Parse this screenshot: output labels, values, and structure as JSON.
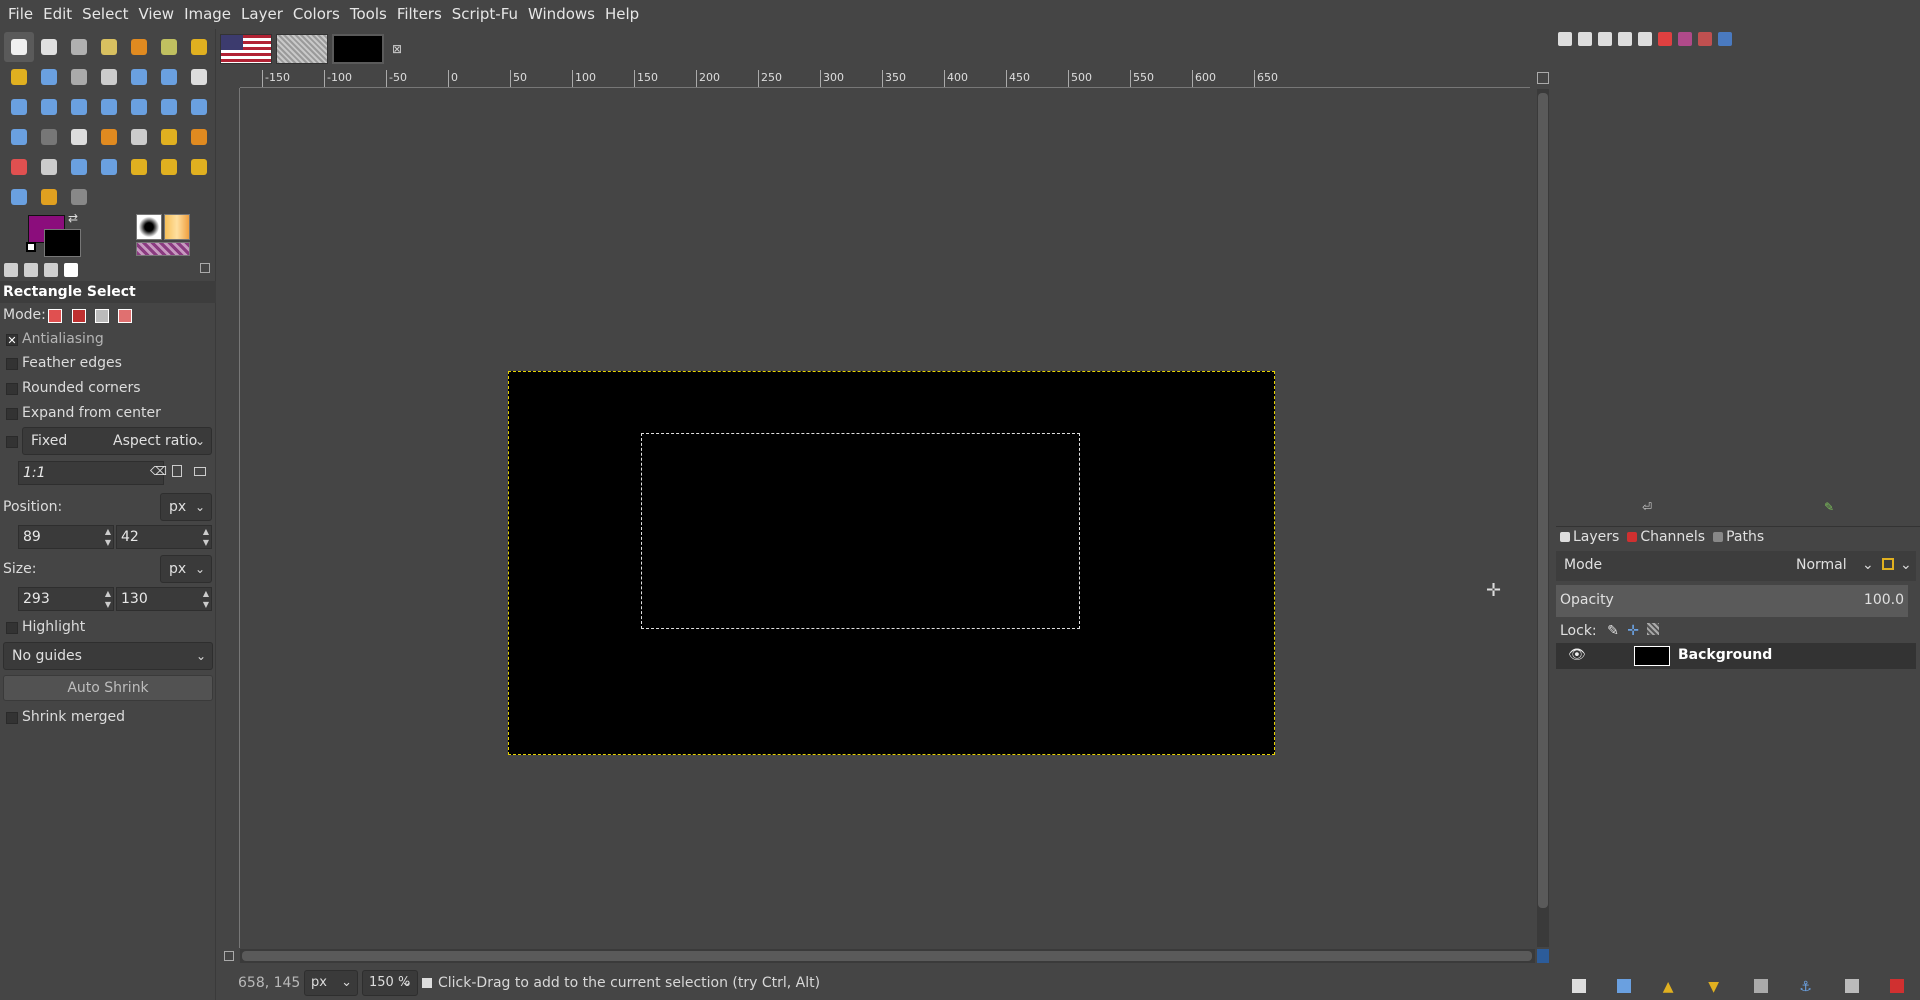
{
  "menubar": {
    "items": [
      "File",
      "Edit",
      "Select",
      "View",
      "Image",
      "Layer",
      "Colors",
      "Tools",
      "Filters",
      "Script-Fu",
      "Windows",
      "Help"
    ]
  },
  "colors": {
    "foreground": "#8b0d7c",
    "background": "#000000",
    "selection_marching": "#e6d200"
  },
  "tool_options": {
    "title": "Rectangle Select",
    "mode_label": "Mode:",
    "antialiasing": "Antialiasing",
    "feather_edges": "Feather edges",
    "rounded_corners": "Rounded corners",
    "expand_from_center": "Expand from center",
    "fixed_label": "Fixed",
    "fixed_value": "Aspect ratio",
    "ratio_value": "1:1",
    "position_label": "Position:",
    "position_unit": "px",
    "position_x": "89",
    "position_y": "42",
    "size_label": "Size:",
    "size_unit": "px",
    "size_w": "293",
    "size_h": "130",
    "highlight": "Highlight",
    "guides_value": "No guides",
    "auto_shrink": "Auto Shrink",
    "shrink_merged": "Shrink merged"
  },
  "ruler": {
    "labels": [
      "-150",
      "-100",
      "-50",
      "0",
      "50",
      "100",
      "150",
      "200",
      "250",
      "300",
      "350",
      "400",
      "450",
      "500",
      "550",
      "600",
      "650"
    ]
  },
  "statusbar": {
    "coords": "658, 145",
    "unit": "px",
    "zoom": "150 %",
    "message": "Click-Drag to add to the current selection (try Ctrl, Alt)"
  },
  "layers": {
    "tabs": [
      "Layers",
      "Channels",
      "Paths"
    ],
    "mode_label": "Mode",
    "mode_value": "Normal",
    "opacity_label": "Opacity",
    "opacity_value": "100.0",
    "lock_label": "Lock:",
    "layer_name": "Background"
  },
  "icons": {
    "tools": [
      "rect-select-icon",
      "ellipse-select-icon",
      "free-select-icon",
      "fuzzy-select-icon",
      "select-by-color-icon",
      "scissors-icon",
      "foreground-select-icon",
      "paths-icon",
      "color-picker-icon",
      "zoom-icon",
      "measure-icon",
      "move-icon",
      "align-icon",
      "crop-icon",
      "unified-transform-icon",
      "rotate-icon",
      "scale-icon",
      "shear-icon",
      "warp-icon",
      "perspective-icon",
      "flip-icon",
      "cage-icon",
      "handle-transform-icon",
      "text-icon",
      "bucket-fill-icon",
      "gradient-icon",
      "pencil-icon",
      "paintbrush-icon",
      "eraser-icon",
      "airbrush-icon",
      "ink-icon",
      "mypaint-brush-icon",
      "clone-icon",
      "heal-icon",
      "perspective-clone-icon",
      "blur-icon",
      "smudge-icon",
      "dodge-burn-icon"
    ]
  }
}
